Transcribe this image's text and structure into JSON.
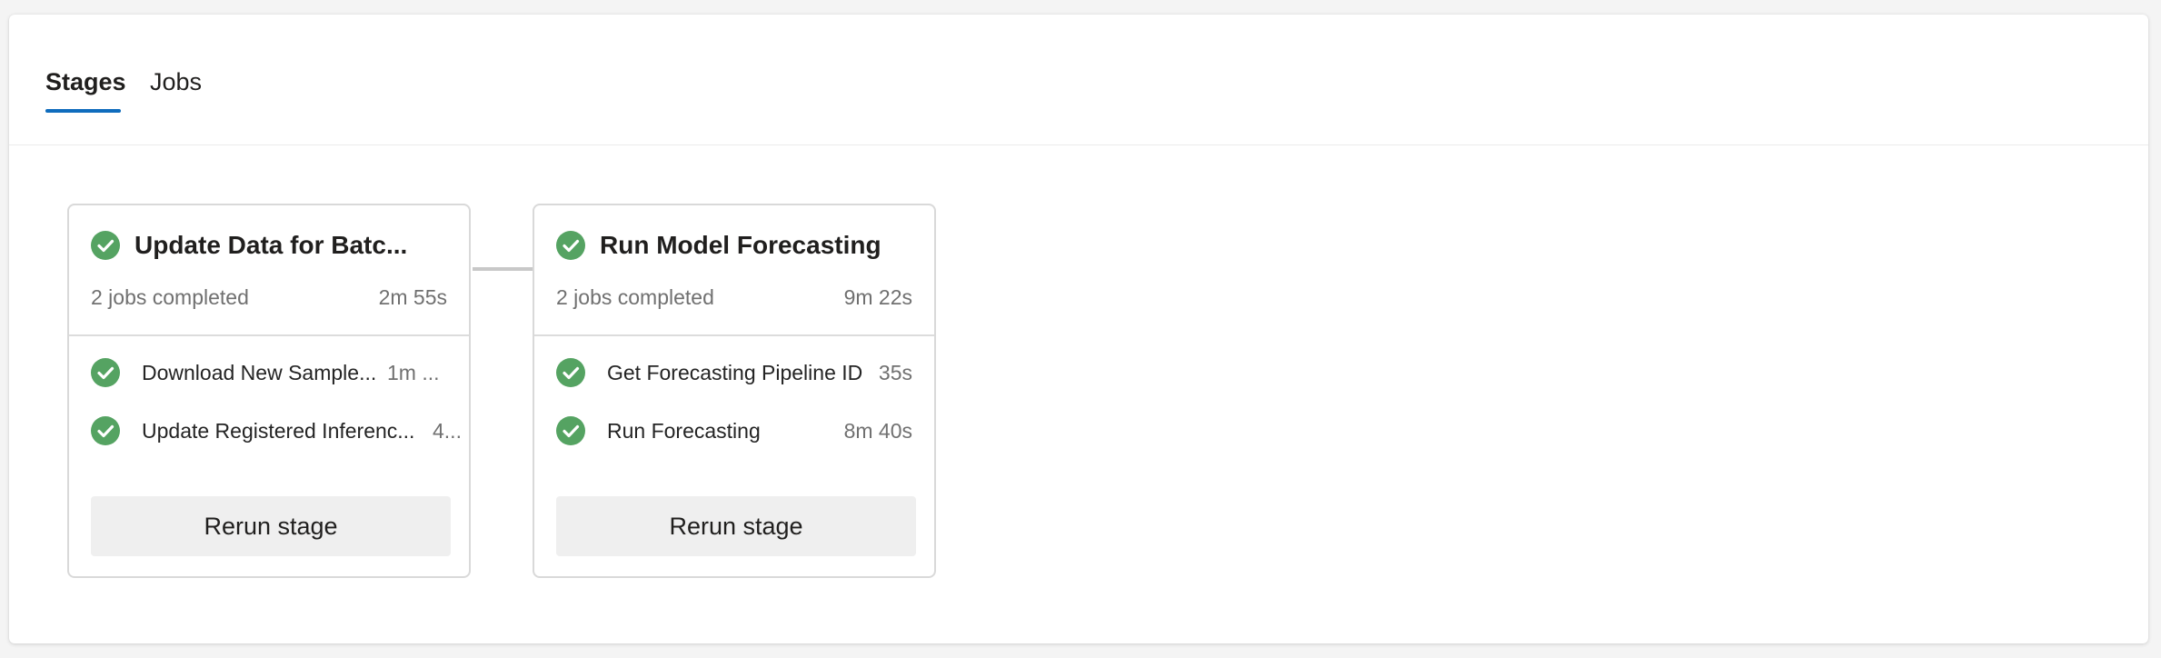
{
  "tabs": [
    {
      "label": "Stages",
      "active": true
    },
    {
      "label": "Jobs",
      "active": false
    }
  ],
  "colors": {
    "success": "#55a362",
    "accent": "#0f6cbd",
    "connector": "#c8c8c8"
  },
  "stages": [
    {
      "title": "Update Data for Batc...",
      "status": "succeeded",
      "summary": "2 jobs completed",
      "duration": "2m 55s",
      "status_icon": "check-circle-icon",
      "jobs": [
        {
          "name": "Download New Sample...",
          "duration": "1m ...",
          "status": "succeeded"
        },
        {
          "name": "Update Registered Inferenc...",
          "duration": "4...",
          "status": "succeeded"
        }
      ],
      "rerun_label": "Rerun stage"
    },
    {
      "title": "Run Model Forecasting",
      "status": "succeeded",
      "summary": "2 jobs completed",
      "duration": "9m 22s",
      "status_icon": "check-circle-icon",
      "jobs": [
        {
          "name": "Get Forecasting Pipeline ID",
          "duration": "35s",
          "status": "succeeded"
        },
        {
          "name": "Run Forecasting",
          "duration": "8m 40s",
          "status": "succeeded"
        }
      ],
      "rerun_label": "Rerun stage"
    }
  ]
}
